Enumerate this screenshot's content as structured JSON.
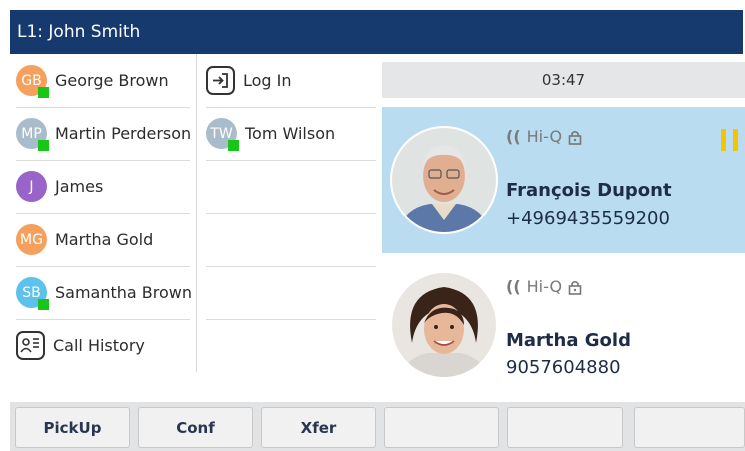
{
  "header": {
    "line_label": "L1: John Smith"
  },
  "contacts_col1": [
    {
      "initials": "GB",
      "name": "George Brown",
      "avatar_color": "#f5a05c",
      "presence": true
    },
    {
      "initials": "MP",
      "name": "Martin Perderson",
      "avatar_color": "#a9bccb",
      "presence": true
    },
    {
      "initials": "J",
      "name": "James",
      "avatar_color": "#9a63c9",
      "presence": false
    },
    {
      "initials": "MG",
      "name": "Martha Gold",
      "avatar_color": "#f5a05c",
      "presence": false
    },
    {
      "initials": "SB",
      "name": "Samantha Brown",
      "avatar_color": "#5cc2ec",
      "presence": true
    },
    {
      "icon": "call-history-icon",
      "name": "Call History"
    }
  ],
  "contacts_col2": [
    {
      "icon": "login-icon",
      "name": "Log In"
    },
    {
      "initials": "TW",
      "name": "Tom Wilson",
      "avatar_color": "#a9bccb",
      "presence": true
    }
  ],
  "timer": "03:47",
  "calls": [
    {
      "hd_label": "Hi-Q",
      "name": "François Dupont",
      "number": "+4969435559200",
      "state": "active",
      "highlight_color": "#b9dcf0",
      "hold_icon": "pause-icon"
    },
    {
      "hd_label": "Hi-Q",
      "name": "Martha Gold",
      "number": "9057604880",
      "state": "held"
    }
  ],
  "softkeys": [
    "PickUp",
    "Conf",
    "Xfer",
    "",
    "",
    ""
  ],
  "colors": {
    "header_bg": "#163a6e",
    "presence": "#18c618",
    "pause": "#f4c400"
  }
}
